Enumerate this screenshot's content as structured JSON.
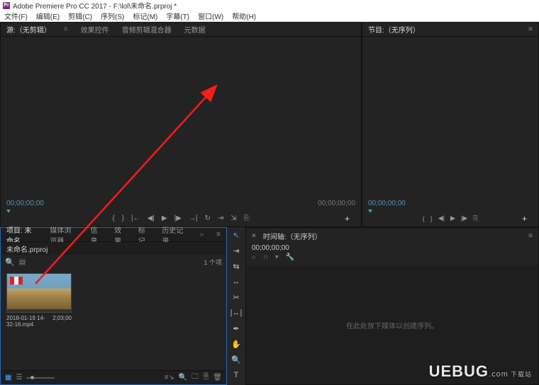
{
  "titlebar": {
    "app_icon": "Pr",
    "title": "Adobe Premiere Pro CC 2017 - F:\\lol\\未命名.prproj *"
  },
  "menubar": {
    "items": [
      "文件(F)",
      "编辑(E)",
      "剪辑(C)",
      "序列(S)",
      "标记(M)",
      "字幕(T)",
      "窗口(W)",
      "帮助(H)"
    ]
  },
  "source_panel": {
    "tabs": [
      "源:（无剪辑）",
      "效果控件",
      "音频剪辑混合器",
      "元数据"
    ],
    "active_tab": 0,
    "tc_left": "00;00;00;00",
    "tc_right": "00;00;00;00"
  },
  "program_panel": {
    "title": "节目:（无序列）",
    "tc_left": "00;00;00;00"
  },
  "project_panel": {
    "tabs": [
      "项目: 未命名",
      "媒体浏览器",
      "信息",
      "效果",
      "标记",
      "历史记录"
    ],
    "active_tab": 0,
    "project_file": "未命名.prproj",
    "item_count": "1 个项",
    "clip": {
      "name": "2018-01-19 14-32-16.mp4",
      "duration": "2;03;00"
    }
  },
  "tools": {
    "items": [
      "selection",
      "track-select",
      "ripple",
      "razor",
      "slip",
      "pen",
      "hand",
      "zoom",
      "type"
    ]
  },
  "timeline_panel": {
    "tab": "时间轴:（无序列）",
    "tc": "00;00;00;00",
    "empty_hint": "在此处放下媒体以创建序列。"
  },
  "transport_icons": {
    "mark_in": "{",
    "mark_out": "}",
    "go_in": "|←",
    "step_back": "◀|",
    "play": "▶",
    "step_fwd": "|▶",
    "go_out": "→|",
    "loop": "↻",
    "export": "⎘",
    "plus": "+"
  },
  "watermark": {
    "brand": "UEBUG",
    "sub": "下载站",
    "com": ".com"
  }
}
